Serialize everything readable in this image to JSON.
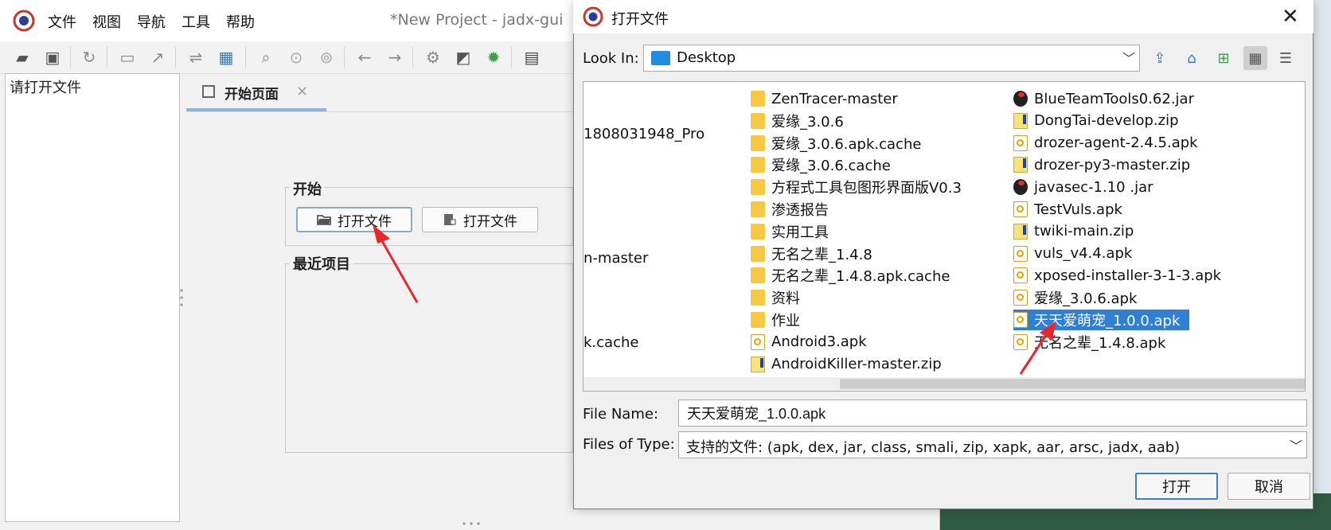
{
  "jadx": {
    "menu": [
      "文件",
      "视图",
      "导航",
      "工具",
      "帮助"
    ],
    "title": "*New Project - jadx-gui",
    "tree_placeholder": "请打开文件",
    "tab_label": "开始页面",
    "tab_close": "×",
    "start_group_title": "开始",
    "open_file_button": "打开文件",
    "open_project_button": "打开文件",
    "recent_group_title": "最近项目",
    "toolbar_icons": [
      "open-folder-icon",
      "add-file-icon",
      "reload-icon",
      "save-icon",
      "export-icon",
      "sync-icon",
      "flatten-icon",
      "search-icon",
      "search-class-icon",
      "search-usage-icon",
      "back-icon",
      "forward-icon",
      "deobfuscation-icon",
      "decompile-icon",
      "debug-bug-icon",
      "log-icon"
    ]
  },
  "dialog": {
    "title": "打开文件",
    "close": "✕",
    "look_in_label": "Look In:",
    "look_in_value": "Desktop",
    "file_name_label": "File Name:",
    "file_name_value": "天天爱萌宠_1.0.0.apk",
    "files_of_type_label": "Files of Type:",
    "files_of_type_value": "支持的文件: (apk, dex, jar, class, smali, zip, xapk, aar, arsc, jadx, aab)",
    "open_button": "打开",
    "cancel_button": "取消",
    "columns": [
      [
        {
          "name": "1808031948_Pro",
          "type": "partial"
        },
        {
          "name": "n-master",
          "type": "partial"
        },
        {
          "name": "k.cache",
          "type": "partial"
        }
      ],
      [
        {
          "name": "ZenTracer-master",
          "type": "folder"
        },
        {
          "name": "爱缘_3.0.6",
          "type": "folder"
        },
        {
          "name": "爱缘_3.0.6.apk.cache",
          "type": "folder"
        },
        {
          "name": "爱缘_3.0.6.cache",
          "type": "folder"
        },
        {
          "name": "方程式工具包图形界面版V0.3",
          "type": "folder"
        },
        {
          "name": "渗透报告",
          "type": "folder"
        },
        {
          "name": "实用工具",
          "type": "folder"
        },
        {
          "name": "无名之辈_1.4.8",
          "type": "folder"
        },
        {
          "name": "无名之辈_1.4.8.apk.cache",
          "type": "folder"
        },
        {
          "name": "资料",
          "type": "folder"
        },
        {
          "name": "作业",
          "type": "folder"
        },
        {
          "name": "Android3.apk",
          "type": "apk"
        },
        {
          "name": "AndroidKiller-master.zip",
          "type": "zip"
        }
      ],
      [
        {
          "name": "BlueTeamTools0.62.jar",
          "type": "jar"
        },
        {
          "name": "DongTai-develop.zip",
          "type": "zip"
        },
        {
          "name": "drozer-agent-2.4.5.apk",
          "type": "apk"
        },
        {
          "name": "drozer-py3-master.zip",
          "type": "zip"
        },
        {
          "name": "javasec-1.10 .jar",
          "type": "jar"
        },
        {
          "name": "TestVuls.apk",
          "type": "apk"
        },
        {
          "name": "twiki-main.zip",
          "type": "zip"
        },
        {
          "name": "vuls_v4.4.apk",
          "type": "apk"
        },
        {
          "name": "xposed-installer-3-1-3.apk",
          "type": "apk"
        },
        {
          "name": "爱缘_3.0.6.apk",
          "type": "apk"
        },
        {
          "name": "天天爱萌宠_1.0.0.apk",
          "type": "apk",
          "selected": true
        },
        {
          "name": "无名之辈_1.4.8.apk",
          "type": "apk"
        }
      ]
    ]
  },
  "colors": {
    "selection": "#2f7fd2",
    "annotation_arrow": "#e8262b",
    "tab_underline": "#8cb4dc"
  }
}
